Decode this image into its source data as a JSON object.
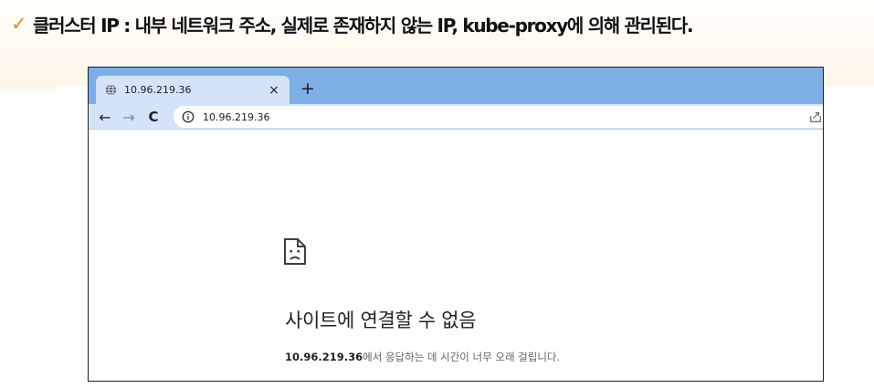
{
  "slide": {
    "heading": "클러스터 IP : 내부 네트워크 주소, 실제로 존재하지 않는 IP, kube-proxy에 의해 관리된다.",
    "check_mark": "✓"
  },
  "browser": {
    "tab": {
      "title": "10.96.219.36",
      "close": "×"
    },
    "new_tab": "+",
    "nav": {
      "back": "←",
      "forward": "→",
      "reload": "C"
    },
    "address_bar": {
      "url": "10.96.219.36"
    },
    "icons": [
      "globe-icon",
      "info-icon",
      "share-icon",
      "sad-page-icon"
    ]
  },
  "error_page": {
    "title": "사이트에 연결할 수 없음",
    "host": "10.96.219.36",
    "message": "에서 응답하는 데 시간이 너무 오래 걸립니다."
  },
  "colors": {
    "accent": "#e58a1f",
    "tab_strip": "#7eaee6",
    "toolbar": "#d4e3f8"
  }
}
